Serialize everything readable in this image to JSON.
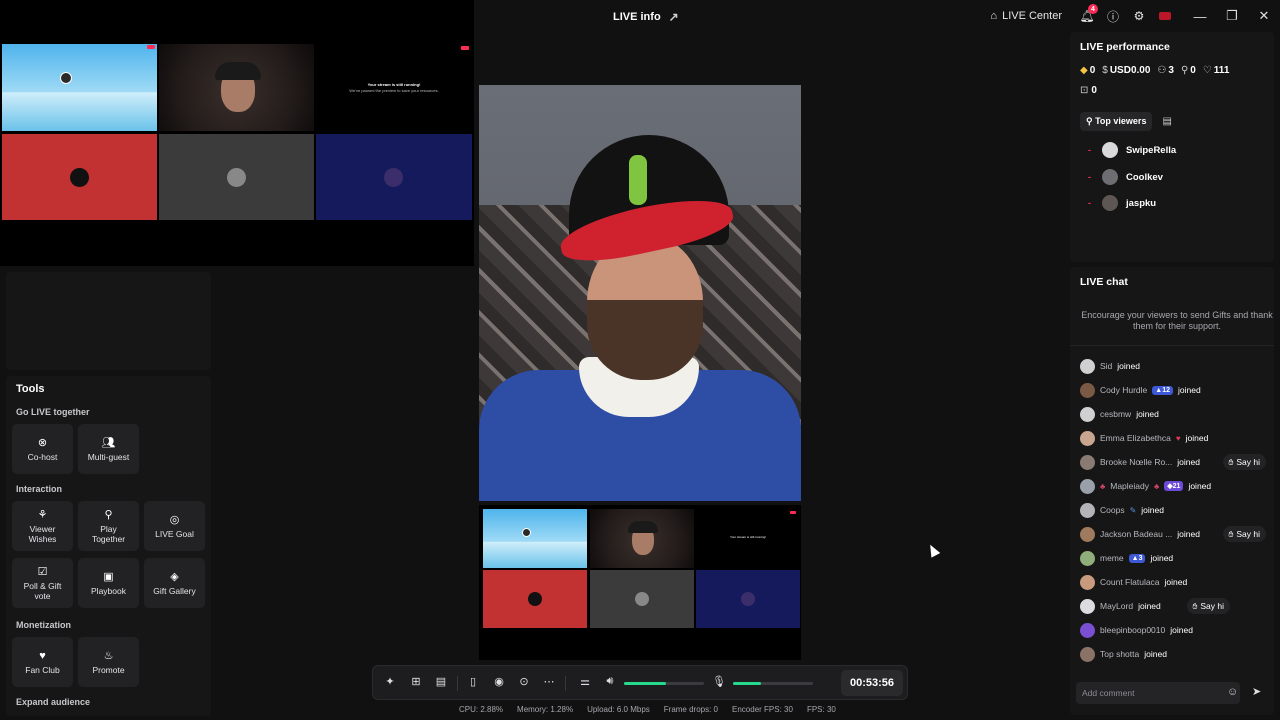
{
  "titlebar": {
    "title": "LIVE info",
    "live_center": "LIVE Center",
    "notification_count": "4"
  },
  "preview": {
    "stream_title": "Your stream is still running!",
    "stream_sub": "We've paused the preview to save your resources."
  },
  "tools": {
    "title": "Tools",
    "go_live_together": "Go LIVE together",
    "cohost": "Co-host",
    "multiguest": "Multi-guest",
    "interaction": "Interaction",
    "viewer_wishes": "Viewer Wishes",
    "play_together": "Play Together",
    "live_goal": "LIVE Goal",
    "poll_gift": "Poll & Gift vote",
    "playbook": "Playbook",
    "gift_gallery": "Gift Gallery",
    "monetization": "Monetization",
    "fan_club": "Fan Club",
    "promote": "Promote",
    "expand_audience": "Expand audience"
  },
  "controls": {
    "timer": "00:53:56",
    "volume_level": 0.52,
    "mic_level": 0.35
  },
  "stats": {
    "cpu": "CPU:  2.88%",
    "memory": "Memory:  1.28%",
    "upload": "Upload:  6.0 Mbps",
    "frame_drops": "Frame drops:  0",
    "encoder_fps": "Encoder FPS:  30",
    "fps": "FPS:  30"
  },
  "performance": {
    "title": "LIVE performance",
    "diamonds": "0",
    "usd": "USD0.00",
    "viewers": "3",
    "new_followers": "0",
    "likes": "111",
    "gifts": "0",
    "top_viewers_tab": "Top viewers",
    "top_viewers": [
      "SwipeRella",
      "Coolkev",
      "jaspku"
    ]
  },
  "chat": {
    "title": "LIVE chat",
    "hint": "Encourage your viewers to send Gifts and thank them for their support.",
    "joined": "joined",
    "say_hi": "Say hi",
    "placeholder": "Add comment",
    "messages": [
      {
        "name": "Sid"
      },
      {
        "name": "Cody Hurdle",
        "level": "12"
      },
      {
        "name": "cesbmw"
      },
      {
        "name": "Emma Elizabethca"
      },
      {
        "name": "Brooke Nœlle Ro..."
      },
      {
        "name": "Mapleiady",
        "level": "21"
      },
      {
        "name": "Coops"
      },
      {
        "name": "Jackson Badeau ..."
      },
      {
        "name": "meme",
        "level": "3"
      },
      {
        "name": "Count Flatulaca"
      },
      {
        "name": "MayLord"
      },
      {
        "name": "bleepinboop0010"
      },
      {
        "name": "Top shotta"
      }
    ]
  }
}
